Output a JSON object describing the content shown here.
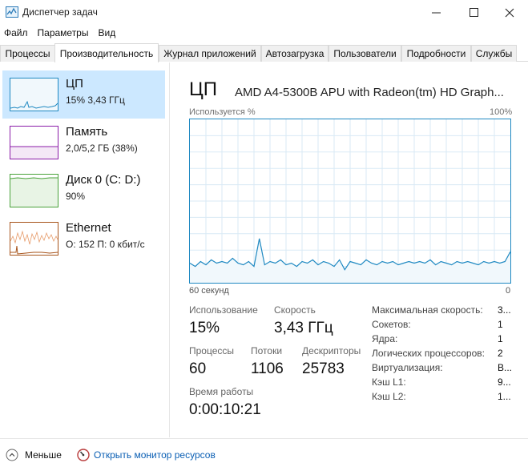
{
  "window": {
    "title": "Диспетчер задач"
  },
  "menu": [
    "Файл",
    "Параметры",
    "Вид"
  ],
  "tabs": [
    "Процессы",
    "Производительность",
    "Журнал приложений",
    "Автозагрузка",
    "Пользователи",
    "Подробности",
    "Службы"
  ],
  "active_tab": "Производительность",
  "sidebar": [
    {
      "name": "ЦП",
      "sub": "15% 3,43 ГГц",
      "color": "#1f89c2",
      "fill": "#f1f8fc"
    },
    {
      "name": "Память",
      "sub": "2,0/5,2 ГБ (38%)",
      "color": "#8b1da8",
      "fill": "#f4e8f6"
    },
    {
      "name": "Диск 0 (C: D:)",
      "sub": "90%",
      "color": "#4aa23b",
      "fill": "#e8f4e5"
    },
    {
      "name": "Ethernet",
      "sub": "О: 152 П: 0 кбит/с",
      "color": "#a7541b",
      "fill": "#ffffff"
    }
  ],
  "main": {
    "title": "ЦП",
    "model": "AMD A4-5300B APU with Radeon(tm) HD Graph...",
    "graph_label_left": "Используется %",
    "graph_label_right": "100%",
    "axis_left": "60 секунд",
    "axis_right": "0",
    "accent_color": "#1f89c2"
  },
  "cpu_usage_series": [
    12,
    10,
    13,
    11,
    14,
    12,
    13,
    12,
    15,
    12,
    11,
    13,
    10,
    27,
    11,
    13,
    12,
    14,
    11,
    12,
    10,
    13,
    12,
    14,
    11,
    13,
    12,
    10,
    14,
    8,
    13,
    12,
    11,
    14,
    12,
    11,
    13,
    12,
    13,
    11,
    12,
    13,
    12,
    13,
    12,
    14,
    11,
    13,
    12,
    11,
    13,
    12,
    13,
    12,
    11,
    13,
    12,
    13,
    12,
    13,
    19
  ],
  "stats": {
    "usage_label": "Использование",
    "usage_value": "15%",
    "speed_label": "Скорость",
    "speed_value": "3,43 ГГц",
    "processes_label": "Процессы",
    "processes_value": "60",
    "threads_label": "Потоки",
    "threads_value": "1106",
    "handles_label": "Дескрипторы",
    "handles_value": "25783",
    "uptime_label": "Время работы",
    "uptime_value": "0:00:10:21"
  },
  "specs": [
    {
      "label": "Максимальная скорость:",
      "value": "3..."
    },
    {
      "label": "Сокетов:",
      "value": "1"
    },
    {
      "label": "Ядра:",
      "value": "1"
    },
    {
      "label": "Логических процессоров:",
      "value": "2"
    },
    {
      "label": "Виртуализация:",
      "value": "В..."
    },
    {
      "label": "Кэш L1:",
      "value": "9..."
    },
    {
      "label": "Кэш L2:",
      "value": "1..."
    }
  ],
  "footer": {
    "less_label": "Меньше",
    "monitor_link": "Открыть монитор ресурсов"
  }
}
